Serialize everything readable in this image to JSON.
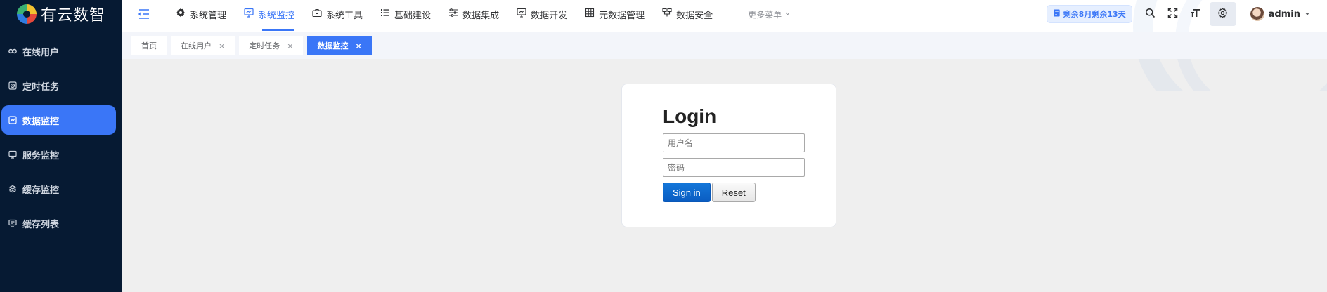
{
  "app": {
    "brand": "有云数智"
  },
  "sidebar": {
    "items": [
      {
        "label": "在线用户",
        "icon": "link-icon",
        "active": false
      },
      {
        "label": "定时任务",
        "icon": "clock-icon",
        "active": false
      },
      {
        "label": "数据监控",
        "icon": "monitor-chart-icon",
        "active": true
      },
      {
        "label": "服务监控",
        "icon": "screen-icon",
        "active": false
      },
      {
        "label": "缓存监控",
        "icon": "layers-icon",
        "active": false
      },
      {
        "label": "缓存列表",
        "icon": "list-screen-icon",
        "active": false
      }
    ]
  },
  "topnav": {
    "items": [
      {
        "label": "系统管理",
        "icon": "gear-icon"
      },
      {
        "label": "系统监控",
        "icon": "monitor-icon",
        "active": true
      },
      {
        "label": "系统工具",
        "icon": "toolbox-icon"
      },
      {
        "label": "基础建设",
        "icon": "list-icon"
      },
      {
        "label": "数据集成",
        "icon": "sliders-icon"
      },
      {
        "label": "数据开发",
        "icon": "chart-screen-icon"
      },
      {
        "label": "元数据管理",
        "icon": "grid-icon"
      },
      {
        "label": "数据安全",
        "icon": "shield-icon"
      }
    ],
    "more_label": "更多菜单"
  },
  "header": {
    "license_text": "剩余8月剩余13天",
    "user_name": "admin"
  },
  "tabs": [
    {
      "label": "首页",
      "closable": false,
      "active": false
    },
    {
      "label": "在线用户",
      "closable": true,
      "active": false
    },
    {
      "label": "定时任务",
      "closable": true,
      "active": false
    },
    {
      "label": "数据监控",
      "closable": true,
      "active": true
    }
  ],
  "tab_close_glyph": "×",
  "login": {
    "title": "Login",
    "username_placeholder": "用户名",
    "password_placeholder": "密码",
    "signin_label": "Sign in",
    "reset_label": "Reset"
  },
  "colors": {
    "accent": "#3a76f7",
    "sidebar_bg": "#061a33",
    "content_bg": "#efefef"
  }
}
